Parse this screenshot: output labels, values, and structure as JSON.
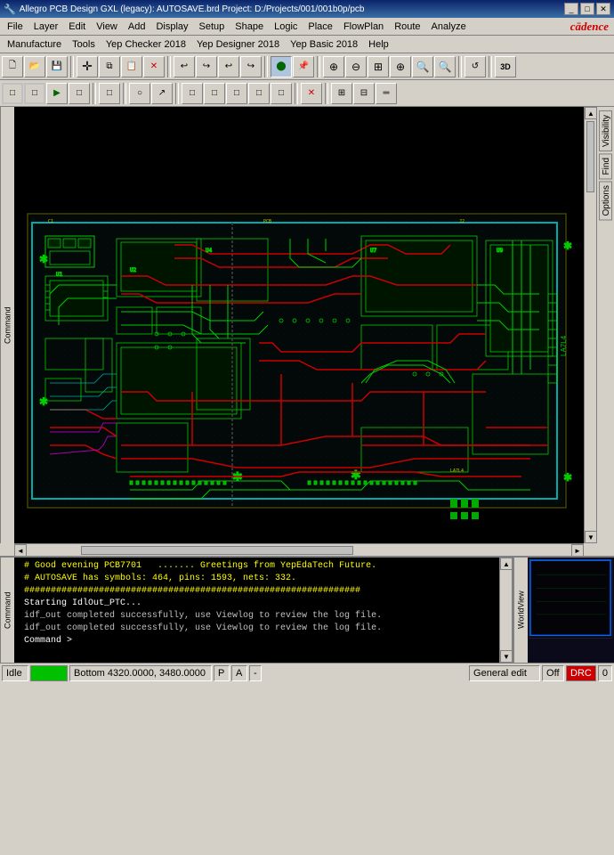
{
  "titleBar": {
    "icon": "🔧",
    "title": "Allegro PCB Design GXL (legacy): AUTOSAVE.brd  Project: D:/Projects/001/001b0p/pcb",
    "minimizeLabel": "_",
    "maximizeLabel": "□",
    "closeLabel": "✕"
  },
  "menuBar1": {
    "items": [
      "File",
      "Edit",
      "View",
      "Add",
      "Display",
      "Setup",
      "Shape",
      "Logic",
      "Place",
      "FlowPlan",
      "Route",
      "Analyze"
    ]
  },
  "menuBar2": {
    "items": [
      "Manufacture",
      "Tools",
      "Yep Checker 2018",
      "Yep Designer 2018",
      "Yep Basic 2018",
      "Help"
    ]
  },
  "cadence": {
    "logo": "cādence"
  },
  "rightPanel": {
    "tabs": [
      "Visibility",
      "Find",
      "Options"
    ]
  },
  "console": {
    "label": "Command",
    "lines": [
      "# Good evening PCB7701     ....... Greetings from YepEdaTech Future.",
      "# AUTOSAVE has symbols: 464, pins: 1593, nets: 332.",
      "###############################################################",
      "Starting IdlOut_PTC...",
      "idf_out completed successfully, use Viewlog to review the log file.",
      "idf_out completed successfully, use Viewlog to review the log file.",
      "Command >"
    ]
  },
  "worldView": {
    "label": "WorldView"
  },
  "statusBar": {
    "status": "Idle",
    "greenIndicator": "",
    "position": "Bottom  4320.0000, 3480.0000",
    "pLabel": "P",
    "aLabel": "A",
    "dash": "-",
    "editMode": "General edit",
    "offLabel": "Off",
    "drcLabel": "DRC",
    "zeroLabel": "0"
  },
  "toolbar1": {
    "buttons": [
      {
        "icon": "📁",
        "name": "new"
      },
      {
        "icon": "📂",
        "name": "open"
      },
      {
        "icon": "💾",
        "name": "save"
      },
      {
        "icon": "✚",
        "name": "add"
      },
      {
        "icon": "📋",
        "name": "copy"
      },
      {
        "icon": "✕",
        "name": "delete"
      },
      {
        "icon": "↩",
        "name": "undo"
      },
      {
        "icon": "↪",
        "name": "redo"
      },
      {
        "icon": "↩",
        "name": "undo2"
      },
      {
        "icon": "↪",
        "name": "redo2"
      },
      {
        "icon": "⬤",
        "name": "circle"
      },
      {
        "icon": "📌",
        "name": "pin"
      },
      {
        "icon": "🔍",
        "name": "zoom-in"
      },
      {
        "icon": "🔍",
        "name": "zoom-out"
      },
      {
        "icon": "🔎",
        "name": "zoom-fit"
      },
      {
        "icon": "⊕",
        "name": "zoom-area"
      },
      {
        "icon": "⊕",
        "name": "zoom-all"
      },
      {
        "icon": "⊕",
        "name": "zoom-prev"
      },
      {
        "icon": "↺",
        "name": "refresh"
      },
      {
        "icon": "3D",
        "name": "3d-view"
      }
    ]
  },
  "toolbar2": {
    "buttons": [
      {
        "icon": "□",
        "name": "tb2-1"
      },
      {
        "icon": "□",
        "name": "tb2-2"
      },
      {
        "icon": "▶",
        "name": "tb2-3"
      },
      {
        "icon": "□",
        "name": "tb2-4"
      },
      {
        "icon": "□",
        "name": "tb2-5"
      },
      {
        "icon": "□",
        "name": "tb2-6"
      },
      {
        "icon": "○",
        "name": "tb2-7"
      },
      {
        "icon": "➜",
        "name": "tb2-8"
      },
      {
        "icon": "□",
        "name": "tb2-9"
      },
      {
        "icon": "□",
        "name": "tb2-10"
      },
      {
        "icon": "□",
        "name": "tb2-11"
      },
      {
        "icon": "□",
        "name": "tb2-12"
      },
      {
        "icon": "□",
        "name": "tb2-13"
      },
      {
        "icon": "✕",
        "name": "tb2-14"
      },
      {
        "icon": "⊞",
        "name": "tb2-15"
      },
      {
        "icon": "⊟",
        "name": "tb2-16"
      },
      {
        "icon": "⊠",
        "name": "tb2-17"
      }
    ]
  },
  "colors": {
    "pcbBackground": "#000000",
    "pcbGreen": "#00cc00",
    "pcbRed": "#cc0000",
    "pcbCyan": "#00cccc",
    "pcbYellow": "#cccc00",
    "pcbMagenta": "#cc00cc",
    "accent": "#0a246a",
    "titleBg": "#3a6ea5"
  }
}
